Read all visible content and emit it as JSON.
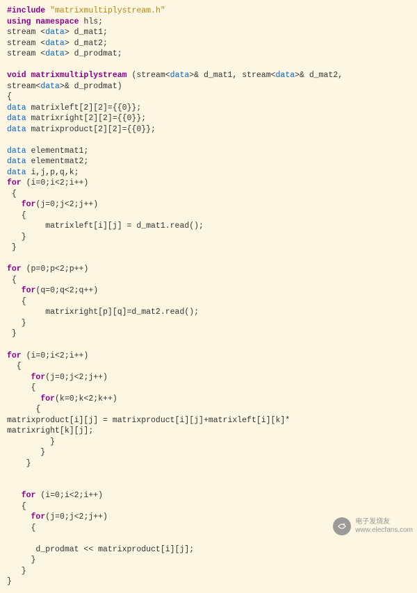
{
  "code": {
    "include_kw": "#include",
    "include_file": "\"matrixmultiplystream.h\"",
    "using_kw": "using namespace",
    "using_ns": "hls;",
    "stream_decl1a": "stream <",
    "stream_type": "data",
    "stream_decl1b": "> d_mat1;",
    "stream_decl2b": "> d_mat2;",
    "stream_decl3b": "> d_prodmat;",
    "void_kw": "void",
    "fn_name": "matrixmultiplystream",
    "fn_params1": " (stream<",
    "fn_params2": ">& d_mat1, stream<",
    "fn_params3": ">& d_mat2,",
    "fn_params4_pre": "stream<",
    "fn_params4_post": ">& d_prodmat)",
    "brace_open": "{",
    "decl_mleft": " matrixleft[2][2]={{0}};",
    "decl_mright": " matrixright[2][2]={{0}};",
    "decl_mprod": " matrixproduct[2][2]={{0}};",
    "decl_em1": " elementmat1;",
    "decl_em2": " elementmat2;",
    "decl_ijk": " i,j,p,q,k;",
    "for_kw": "for",
    "for_i": " (i=0;i<2;i++)",
    "for_j": "(j=0;j<2;j++)",
    "for_p": " (p=0;p<2;p++)",
    "for_q": "(q=0;q<2;q++)",
    "for_k": "(k=0;k<2;k++)",
    "read_left": "        matrixleft[i][j] = d_mat1.read();",
    "read_right": "        matrixright[p][q]=d_mat2.read();",
    "mul_line1": "matrixproduct[i][j] = matrixproduct[i][j]+matrixleft[i][k]*",
    "mul_line2": "matrixright[k][j];",
    "write_line": "      d_prodmat << matrixproduct[i][j];",
    "brace_close": "}",
    "brace_open_i2": " {",
    "brace_open_i3": "  {",
    "brace_open_i4": "   {",
    "brace_open_i5": "    {",
    "brace_open_i6": "     {",
    "brace_open_i7": "      {",
    "brace_close_i2": " }",
    "brace_close_i3": "  }",
    "brace_close_i4": "   }",
    "brace_close_i5": "    }",
    "brace_close_i6": "     }",
    "brace_close_i7": "       }",
    "brace_close_i8": "         }",
    "for_indent3": "   ",
    "for_indent5": "     ",
    "for_indent7": "       "
  },
  "watermark": {
    "line1": "电子发烧友",
    "line2": "www.elecfans.com"
  }
}
